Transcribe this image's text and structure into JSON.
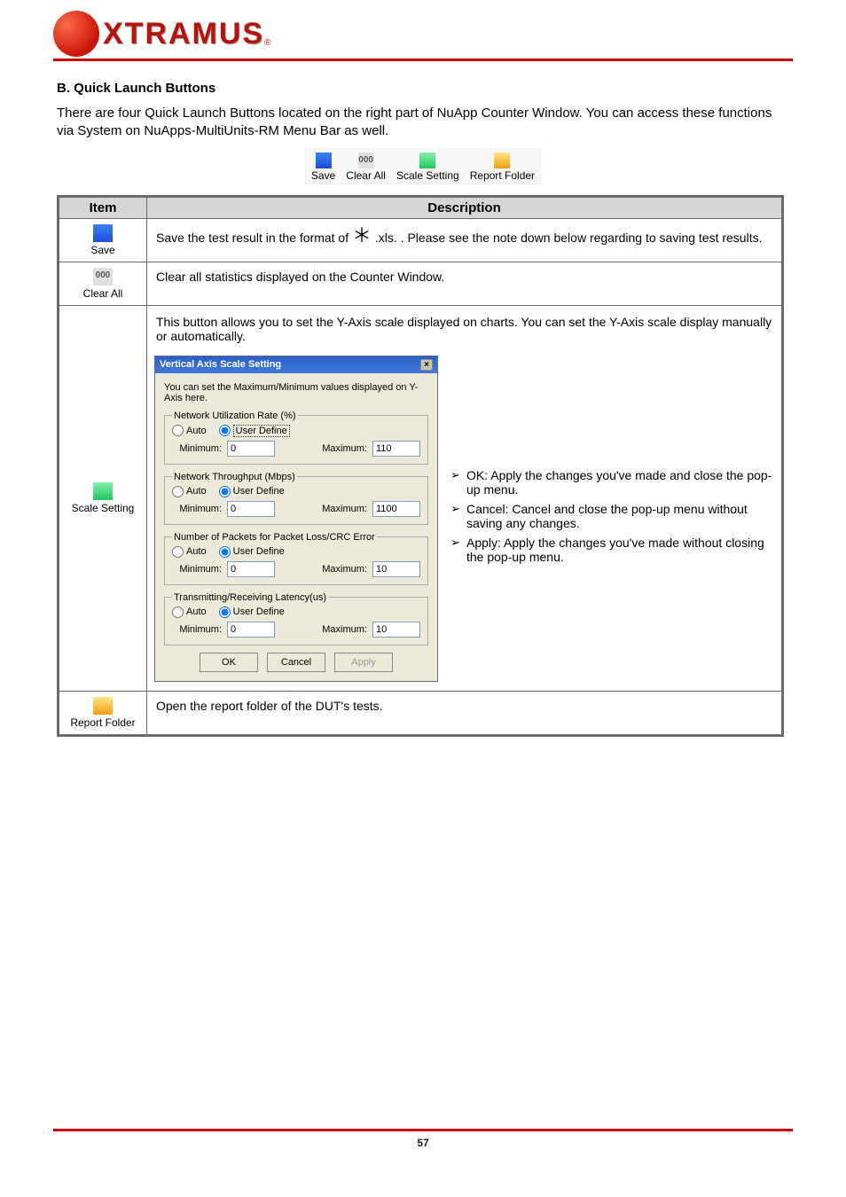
{
  "logo": {
    "text": "XTRAMUS"
  },
  "heading": "B. Quick Launch Buttons",
  "intro": "There are four Quick Launch Buttons located on the right part of NuApp Counter Window. You can access these functions via System on NuApps-MultiUnits-RM Menu Bar as well.",
  "toolbar": {
    "save": "Save",
    "clear": "Clear All",
    "clear_icon": "000",
    "scale": "Scale Setting",
    "report": "Report Folder"
  },
  "table": {
    "hdr_item": "Item",
    "hdr_desc": "Description",
    "save_desc_1": "Save the test result in the format of",
    "save_desc_2": ".xls.",
    "asterisk_note": ".  Please see the note down below regarding to saving test results.",
    "clear_desc": "Clear all statistics displayed on the Counter Window."
  },
  "scale_row": {
    "intro": "This button allows you to set the Y-Axis scale displayed on charts. You can set the Y-Axis scale display manually or automatically.",
    "bullet_ok": "OK: Apply the changes you've made and close the pop-up menu.",
    "bullet_cancel": "Cancel: Cancel and close the pop-up menu without saving any changes.",
    "bullet_apply": "Apply: Apply the changes you've made without closing the pop-up menu."
  },
  "report_desc": "Open the report folder of the DUT's tests.",
  "dialog": {
    "title": "Vertical  Axis Scale Setting",
    "intro": "You can set the Maximum/Minimum values displayed on Y-Axis here.",
    "auto": "Auto",
    "user_define": "User Define",
    "minimum": "Minimum:",
    "maximum": "Maximum:",
    "groups": {
      "util": {
        "legend": "Network Utilization Rate (%)",
        "min": "0",
        "max": "110"
      },
      "thru": {
        "legend": "Network Throughput (Mbps)",
        "min": "0",
        "max": "1100"
      },
      "pkt": {
        "legend": "Number of Packets for Packet Loss/CRC Error",
        "min": "0",
        "max": "10"
      },
      "lat": {
        "legend": "Transmitting/Receiving Latency(us)",
        "min": "0",
        "max": "10"
      }
    },
    "ok": "OK",
    "cancel": "Cancel",
    "apply": "Apply"
  },
  "footer": "57"
}
